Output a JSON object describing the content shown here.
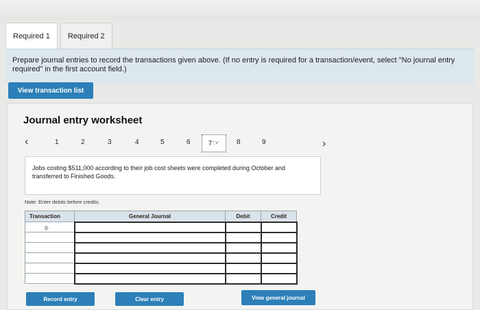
{
  "tabs": [
    {
      "label": "Required 1"
    },
    {
      "label": "Required 2"
    }
  ],
  "instructions": "Prepare journal entries to record the transactions given above. (If no entry is required for a transaction/event, select \"No journal entry required\" in the first account field.)",
  "view_transaction_list_label": "View transaction list",
  "worksheet": {
    "title": "Journal entry worksheet",
    "nav_prev_icon": "chevron-left-icon",
    "nav_next_icon": "chevron-right-icon",
    "nav_numbers": [
      "1",
      "2",
      "3",
      "4",
      "5",
      "6",
      "7",
      "8",
      "9"
    ],
    "current_number": "7",
    "cursor_icon": "hand-pointer-icon",
    "description": "Jobs costing $511,000 according to their job cost sheets were completed during October and transferred to Finished Goods.",
    "note": "Note: Enter debits before credits.",
    "table": {
      "headers": [
        "Transaction",
        "General Journal",
        "Debit",
        "Credit"
      ],
      "first_transaction": "g."
    }
  },
  "buttons": {
    "record": "Record entry",
    "clear": "Clear entry",
    "view_journal": "View general journal"
  },
  "colors": {
    "accent": "#2c7fb8",
    "instruction_bg": "#dde8ee",
    "header_bg": "#dbe3ea"
  }
}
